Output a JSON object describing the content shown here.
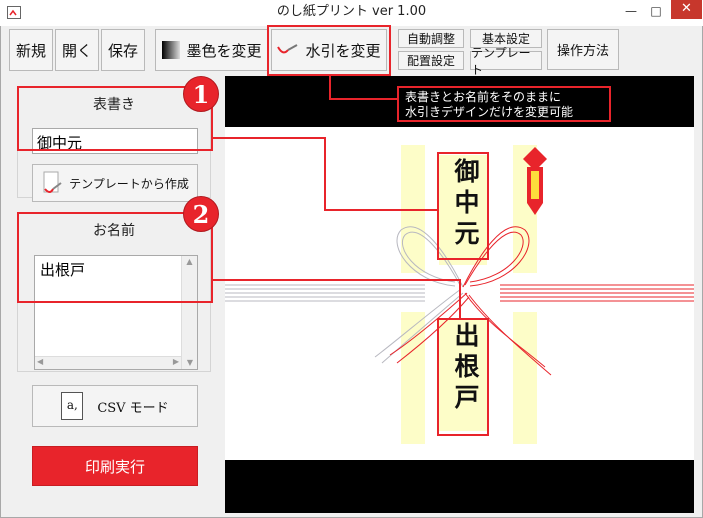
{
  "window": {
    "title": "のし紙プリント ver 1.00",
    "minimize": "—",
    "maximize": "□",
    "close": "✕"
  },
  "toolbar": {
    "new": "新規",
    "open": "開く",
    "save": "保存",
    "ink_color": "墨色を変更",
    "mizuhiki": "水引を変更",
    "auto_adjust": "自動調整",
    "basic_settings": "基本設定",
    "layout_settings": "配置設定",
    "template": "テンプレート",
    "howto": "操作方法"
  },
  "left": {
    "omotegaki_label": "表書き",
    "omotegaki_value": "御中元",
    "template_create": "テンプレートから作成",
    "name_label": "お名前",
    "name_value": "出根戸",
    "csv_mode": "CSV モード",
    "csv_icon_text": "a,",
    "print": "印刷実行"
  },
  "callout": {
    "line1": "表書きとお名前をそのままに",
    "line2": "水引きデザインだけを変更可能",
    "badge1": "1",
    "badge2": "2"
  },
  "preview": {
    "omotegaki": "御中元",
    "name": "出根戸"
  },
  "colors": {
    "accent_red": "#e8242b",
    "print_button": "#e8242b",
    "tag_yellow": "#fdfdc8"
  },
  "icons": {
    "app": "noshi-icon",
    "ink": "ink-gradient-icon",
    "mizuhiki": "mizuhiki-icon",
    "template": "noshi-template-icon",
    "csv": "csv-file-icon",
    "noshi_ornament": "noshi-ornament-icon"
  }
}
